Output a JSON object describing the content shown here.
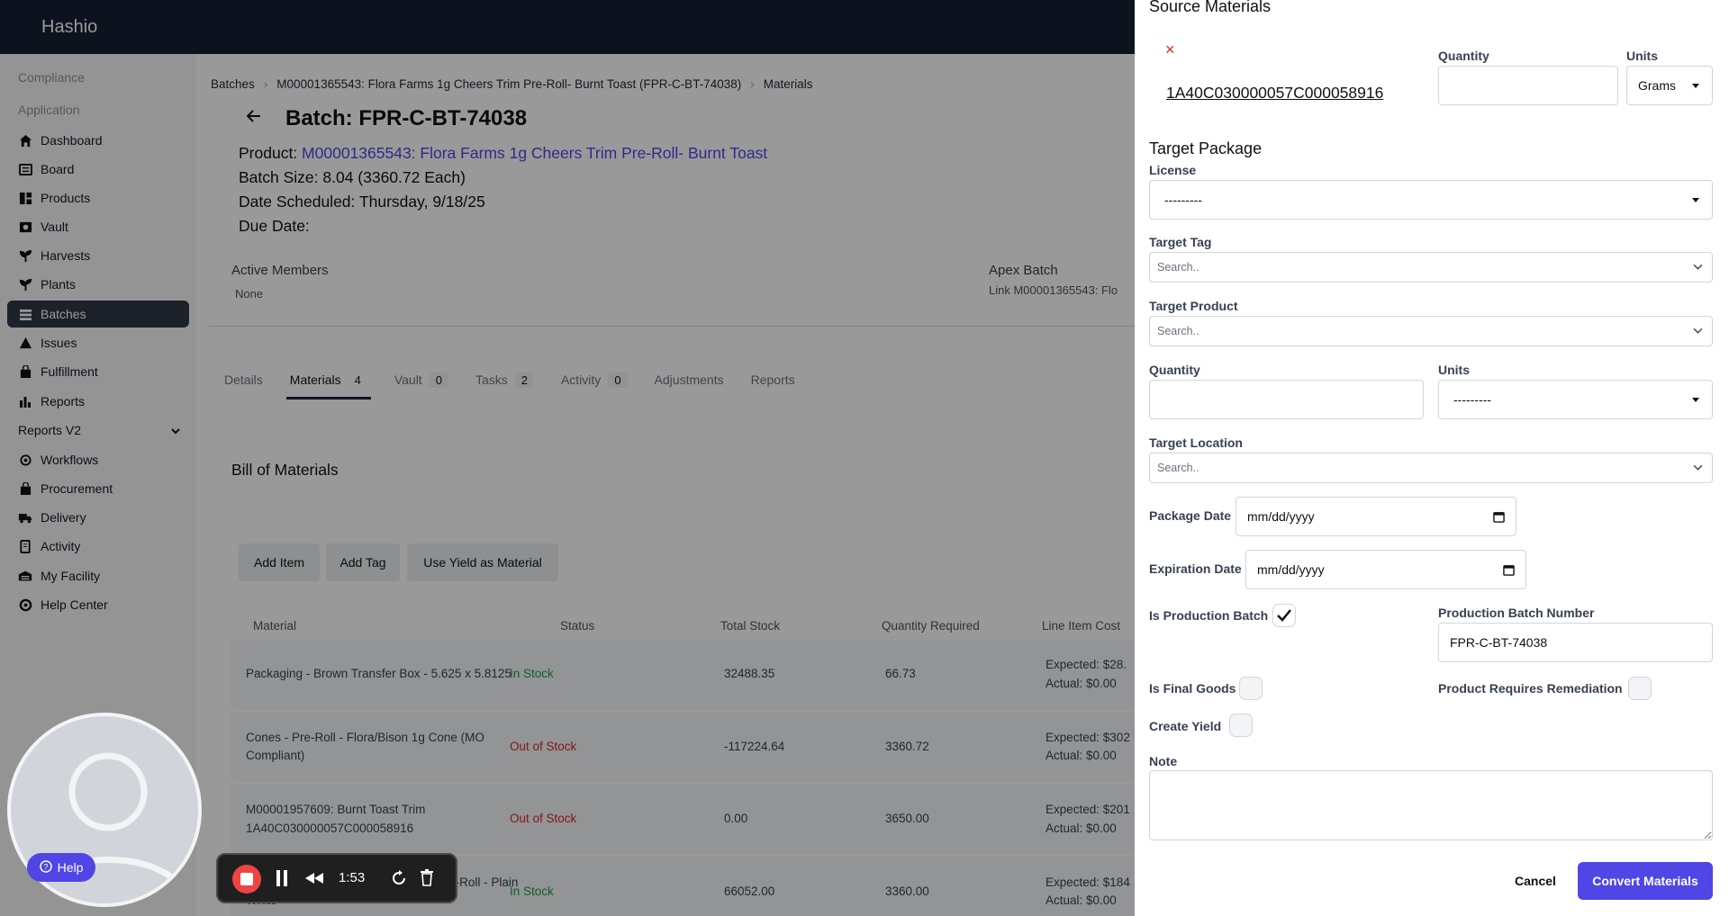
{
  "app": {
    "brand": "Hashio"
  },
  "sidebar": {
    "sections": [
      "Compliance",
      "Application"
    ],
    "items": [
      {
        "label": "Dashboard",
        "icon": "home-icon"
      },
      {
        "label": "Board",
        "icon": "board-icon"
      },
      {
        "label": "Products",
        "icon": "products-icon"
      },
      {
        "label": "Vault",
        "icon": "vault-icon"
      },
      {
        "label": "Harvests",
        "icon": "plant-icon"
      },
      {
        "label": "Plants",
        "icon": "plant-icon"
      },
      {
        "label": "Batches",
        "icon": "batches-icon",
        "active": true
      },
      {
        "label": "Issues",
        "icon": "warning-icon"
      },
      {
        "label": "Fulfillment",
        "icon": "bag-icon"
      },
      {
        "label": "Reports",
        "icon": "bar-chart-icon"
      },
      {
        "label": "Reports V2",
        "icon": "chevron-down-icon"
      },
      {
        "label": "Workflows",
        "icon": "workflow-icon"
      },
      {
        "label": "Procurement",
        "icon": "bag-icon"
      },
      {
        "label": "Delivery",
        "icon": "truck-icon"
      },
      {
        "label": "Activity",
        "icon": "activity-icon"
      },
      {
        "label": "My Facility",
        "icon": "facility-icon"
      },
      {
        "label": "Help Center",
        "icon": "help-icon"
      }
    ]
  },
  "breadcrumb": [
    "Batches",
    "M00001365543: Flora Farms 1g Cheers Trim Pre-Roll- Burnt Toast (FPR-C-BT-74038)",
    "Materials"
  ],
  "batch": {
    "title": "Batch: FPR-C-BT-74038",
    "product_label": "Product: ",
    "product_link": "M00001365543: Flora Farms 1g Cheers Trim Pre-Roll- Burnt Toast",
    "size": "Batch Size: 8.04 (3360.72 Each)",
    "scheduled": "Date Scheduled: Thursday, 9/18/25",
    "due": "Due Date:"
  },
  "members": {
    "label": "Active Members",
    "value": "None"
  },
  "apex": {
    "label": "Apex Batch",
    "value": "Link M00001365543: Flo"
  },
  "tabs": [
    {
      "label": "Details",
      "count": ""
    },
    {
      "label": "Materials",
      "count": "4"
    },
    {
      "label": "Vault",
      "count": "0"
    },
    {
      "label": "Tasks",
      "count": "2"
    },
    {
      "label": "Activity",
      "count": "0"
    },
    {
      "label": "Adjustments",
      "count": ""
    },
    {
      "label": "Reports",
      "count": ""
    }
  ],
  "bom": {
    "title": "Bill of Materials",
    "buttons": [
      "Add Item",
      "Add Tag",
      "Use Yield as Material"
    ],
    "headers": [
      "Material",
      "Status",
      "Total Stock",
      "Quantity Required",
      "Line Item Cost"
    ],
    "rows": [
      {
        "material": "Packaging - Brown Transfer Box - 5.625 x 5.8125",
        "material2": "",
        "status": "In Stock",
        "stock": "32488.35",
        "qty": "66.73",
        "expected": "Expected: $28.",
        "actual": "Actual: $0.00"
      },
      {
        "material": "Cones - Pre-Roll - Flora/Bison 1g Cone (MO",
        "material2": "Compliant)",
        "status": "Out of Stock",
        "stock": "-117224.64",
        "qty": "3360.72",
        "expected": "Expected: $302",
        "actual": "Actual: $0.00"
      },
      {
        "material": "M00001957609: Burnt Toast Trim",
        "material2": "1A40C030000057C000058916",
        "status": "Out of Stock",
        "stock": "0.00",
        "qty": "3650.00",
        "expected": "Expected: $201",
        "actual": "Actual: $0.00"
      },
      {
        "material": "Packaging - Tube - Flora CHEERS Pre-Roll - Plain",
        "material2": "White",
        "status": "In Stock",
        "stock": "66052.00",
        "qty": "3360.00",
        "expected": "Expected: $184",
        "actual": "Actual: $0.00"
      }
    ]
  },
  "panel": {
    "title": "Source Materials",
    "remove_symbol": "×",
    "source_tag": "1A40C030000057C000058916",
    "quantity_label": "Quantity",
    "units_label": "Units",
    "units_value": "Grams",
    "target_title": "Target Package",
    "license_label": "License",
    "license_value": "---------",
    "target_tag_label": "Target Tag",
    "search_placeholder": "Search..",
    "target_product_label": "Target Product",
    "quantity2_label": "Quantity",
    "units2_label": "Units",
    "units2_value": "---------",
    "target_location_label": "Target Location",
    "package_date_label": "Package Date",
    "date_placeholder": "mm/dd/yyyy",
    "expiration_date_label": "Expiration Date",
    "is_production_label": "Is Production Batch",
    "production_number_label": "Production Batch Number",
    "production_number_value": "FPR-C-BT-74038",
    "is_final_label": "Is Final Goods",
    "remediation_label": "Product Requires Remediation",
    "create_yield_label": "Create Yield",
    "note_label": "Note",
    "cancel": "Cancel",
    "convert": "Convert Materials"
  },
  "recorder": {
    "help": "Help",
    "time": "1:53"
  },
  "colors": {
    "accent": "#4f46e5",
    "topbar": "#172033",
    "in_stock": "#16a34a",
    "out_of_stock": "#dc2626"
  }
}
